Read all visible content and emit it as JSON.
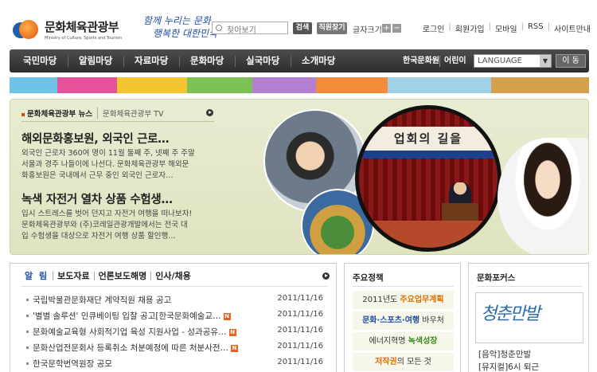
{
  "header": {
    "logo_title": "문화체육관광부",
    "logo_sub": "Ministry of Culture, Sports and Tourism",
    "slogan_line1": "함께 누리는 문화",
    "slogan_line2": "행복한 대한민국",
    "search_placeholder": "찾아보기",
    "search_button": "검색",
    "locate_button": "직원찾기",
    "font_size_label": "글자크기",
    "font_plus": "+",
    "font_minus": "−",
    "utility": [
      "로그인",
      "회원가입",
      "모바일",
      "RSS",
      "사이트만내"
    ]
  },
  "nav": {
    "items": [
      "국민마당",
      "알림마당",
      "자료마당",
      "문화마당",
      "실국마당",
      "소개마당"
    ],
    "korea_site": "한국문화원",
    "where": "어린이",
    "language": "LANGUAGE",
    "move_button": "이 동"
  },
  "strip": {
    "colors": [
      "#6ec3e6",
      "#e3529a",
      "#f2c531",
      "#7cc154",
      "#b47fd0",
      "#f28c3c",
      "#9fd1e8",
      "#d4a04b"
    ]
  },
  "feature": {
    "tab_news": "문화체육관광부 뉴스",
    "tab_tv": "문화체육관광부 TV",
    "news": [
      {
        "title": "해외문화홍보원, 외국인 근로…",
        "body": [
          "외국인 근로자 360여 명이 11월 둘째 주, 넷째 주 주말",
          "서울과 경주 나들이에 나선다. 문화체육관광부 해외문",
          "화홍보원은 국내에서 근무 중인 외국인 근로자…"
        ]
      },
      {
        "title": "녹색 자전거 열차 상품 수험생…",
        "body": [
          "입시 스트레스를 벗어 던지고 자전거 여행을 떠나보자!",
          "문화체육관광부와 (주)코레일관광개발에서는 전국 대",
          "입 수험생을 대상으로 자전거 여행 상품 할인행…"
        ]
      }
    ],
    "photo_banner": "업회의 길을"
  },
  "alim": {
    "tabs": [
      "알 림",
      "보도자료",
      "언론보도해명",
      "인사/채용"
    ],
    "rows": [
      {
        "title": "국립박물관문화재단 계약직원 채용 공고",
        "date": "2011/11/16"
      },
      {
        "title": "'별별 솔루션' 인큐베이팅 입찰 공고[한국문화예술교…",
        "date": "2011/11/16"
      },
      {
        "title": "문화예술교육형 사회적기업 육성 지원사업 - 성과공유…",
        "date": "2011/11/16"
      },
      {
        "title": "문화산업전문회사 등록취소 처분예정에 따른 처분사전…",
        "date": "2011/11/16"
      },
      {
        "title": "한국문학번역원장 공모",
        "date": "2011/11/16"
      }
    ],
    "new_badge": "N"
  },
  "policy": {
    "heading": "주요정책",
    "items": [
      {
        "prefix": "2011년도",
        "suffix": "주요업무계획"
      },
      {
        "prefix": "문화·스포츠·여행",
        "suffix": "바우처"
      },
      {
        "prefix": "에너지혁명",
        "suffix": "녹색성장"
      },
      {
        "prefix": "저작권",
        "suffix": "의 모든 것"
      }
    ]
  },
  "culture": {
    "heading": "문화포커스",
    "image_text": "청춘만발",
    "items": [
      "[음악]청춘만발",
      "[뮤지컬]6시 퇴근"
    ]
  }
}
